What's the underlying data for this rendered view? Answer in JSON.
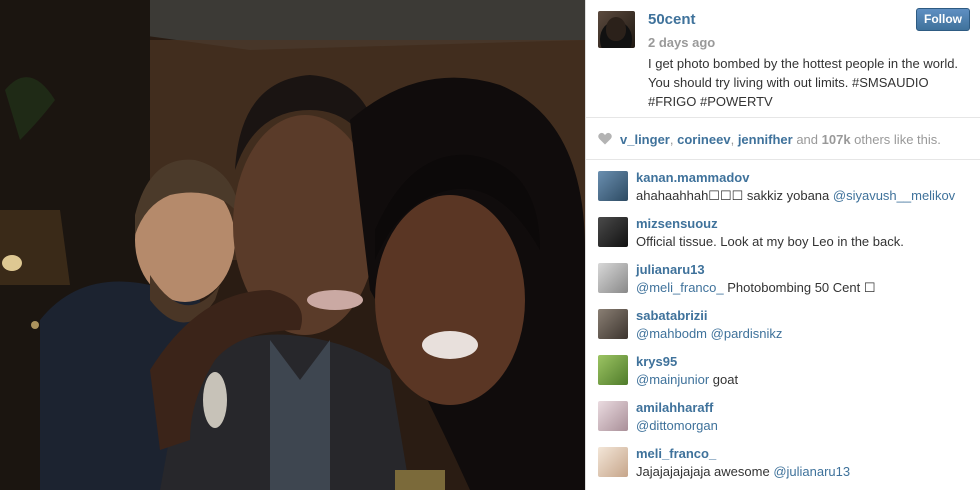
{
  "post": {
    "owner": "50cent",
    "time": "2 days ago",
    "caption": "I get photo bombed by the hottest people in the world. You should try living with out limits. #SMSAUDIO #FRIGO #POWERTV",
    "follow_label": "Follow"
  },
  "likes": {
    "user1": "v_linger",
    "sep1": ", ",
    "user2": "corineev",
    "sep2": ", ",
    "user3": "jennifher",
    "and": " and ",
    "count": "107k",
    "rest": " others like this."
  },
  "comments": [
    {
      "user": "kanan.mammadov",
      "text": "ahahaahhah☐☐☐ sakkiz yobana ",
      "mention": "@siyavush__melikov",
      "avatar_color": "#4a6d8c"
    },
    {
      "user": "mizsensuouz",
      "text": "Official tissue. Look at my boy Leo in the back.",
      "mention": "",
      "avatar_color": "#2a2a2a"
    },
    {
      "user": "julianaru13",
      "text": " Photobombing 50 Cent ☐",
      "mention": "@meli_franco_",
      "mention_first": true,
      "avatar_color": "#b9b9b9"
    },
    {
      "user": "sabatabrizii",
      "text": " ",
      "mention": "@mahbodm",
      "mention2": "@pardisnikz",
      "mention_first": true,
      "avatar_color": "#6b6158"
    },
    {
      "user": "krys95",
      "text": " goat",
      "mention": "@mainjunior",
      "mention_first": true,
      "avatar_color": "#7aa34a"
    },
    {
      "user": "amilahharaff",
      "text": "",
      "mention": "@dittomorgan",
      "mention_first": true,
      "avatar_color": "#d6c3c9"
    },
    {
      "user": "meli_franco_",
      "text": "Jajajajajajaja awesome ",
      "mention": "@julianaru13",
      "avatar_color": "#e8d4c2"
    }
  ],
  "colors": {
    "link": "#3f729b",
    "muted": "#999999",
    "follow_bg": "#3f729b"
  },
  "icons": {
    "likes": "heart-icon"
  }
}
